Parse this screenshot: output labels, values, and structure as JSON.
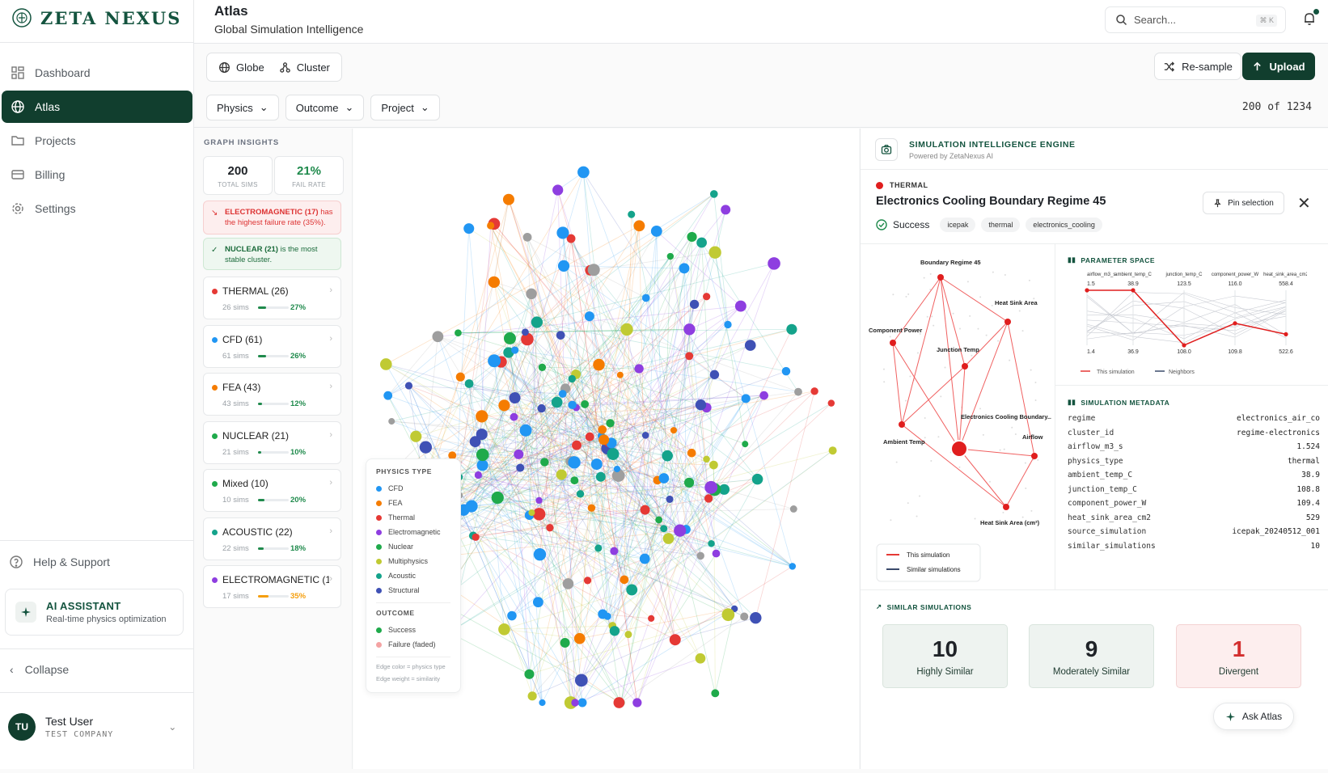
{
  "brand": {
    "name": "ZETA NEXUS"
  },
  "nav": [
    {
      "label": "Dashboard",
      "icon": "grid-icon"
    },
    {
      "label": "Atlas",
      "icon": "globe-icon",
      "active": true
    },
    {
      "label": "Projects",
      "icon": "folder-icon"
    },
    {
      "label": "Billing",
      "icon": "card-icon"
    },
    {
      "label": "Settings",
      "icon": "gear-icon"
    }
  ],
  "help_label": "Help & Support",
  "ai_assistant": {
    "title": "AI ASSISTANT",
    "subtitle": "Real-time physics optimization"
  },
  "collapse_label": "Collapse",
  "user": {
    "initials": "TU",
    "name": "Test User",
    "company": "TEST COMPANY"
  },
  "header": {
    "title": "Atlas",
    "subtitle": "Global Simulation Intelligence",
    "search_placeholder": "Search...",
    "search_kbd": "⌘ K"
  },
  "toolbar": {
    "view_globe": "Globe",
    "view_cluster": "Cluster",
    "resample": "Re-sample",
    "upload": "Upload",
    "filters": [
      "Physics",
      "Outcome",
      "Project"
    ],
    "count": "200 of 1234"
  },
  "insights": {
    "label": "GRAPH INSIGHTS",
    "total_value": "200",
    "total_label": "TOTAL SIMS",
    "fail_value": "21%",
    "fail_label": "FAIL RATE",
    "alert_red_strong": "ELECTROMAGNETIC (17)",
    "alert_red_text": " has the highest failure rate (35%).",
    "alert_green_strong": "NUCLEAR (21)",
    "alert_green_text": " is the most stable cluster.",
    "categories": [
      {
        "name": "THERMAL (26)",
        "sims": "26 sims",
        "pct": "27%",
        "value": 0.27,
        "color": "#e53935",
        "pct_color": "#1f8a4c"
      },
      {
        "name": "CFD (61)",
        "sims": "61 sims",
        "pct": "26%",
        "value": 0.26,
        "color": "#2196f3",
        "pct_color": "#1f8a4c"
      },
      {
        "name": "FEA (43)",
        "sims": "43 sims",
        "pct": "12%",
        "value": 0.12,
        "color": "#f57c00",
        "pct_color": "#1f8a4c"
      },
      {
        "name": "NUCLEAR (21)",
        "sims": "21 sims",
        "pct": "10%",
        "value": 0.1,
        "color": "#1faa4b",
        "pct_color": "#1f8a4c"
      },
      {
        "name": "Mixed (10)",
        "sims": "10 sims",
        "pct": "20%",
        "value": 0.2,
        "color": "#1faa4b",
        "pct_color": "#1f8a4c"
      },
      {
        "name": "ACOUSTIC (22)",
        "sims": "22 sims",
        "pct": "18%",
        "value": 0.18,
        "color": "#14a38b",
        "pct_color": "#1f8a4c"
      },
      {
        "name": "ELECTROMAGNETIC (17)",
        "sims": "17 sims",
        "pct": "35%",
        "value": 0.35,
        "color": "#8e3ee0",
        "pct_color": "#f59e0b"
      }
    ]
  },
  "legend": {
    "physics_title": "PHYSICS TYPE",
    "physics": [
      {
        "label": "CFD",
        "color": "#2196f3"
      },
      {
        "label": "FEA",
        "color": "#f57c00"
      },
      {
        "label": "Thermal",
        "color": "#e53935"
      },
      {
        "label": "Electromagnetic",
        "color": "#8e3ee0"
      },
      {
        "label": "Nuclear",
        "color": "#1faa4b"
      },
      {
        "label": "Multiphysics",
        "color": "#c0ca33"
      },
      {
        "label": "Acoustic",
        "color": "#14a38b"
      },
      {
        "label": "Structural",
        "color": "#3f51b5"
      }
    ],
    "outcome_title": "OUTCOME",
    "outcomes": [
      {
        "label": "Success",
        "color": "#1faa4b"
      },
      {
        "label": "Failure (faded)",
        "color": "#f4a3a3"
      }
    ],
    "note1": "Edge color = physics type",
    "note2": "Edge weight = similarity"
  },
  "engine": {
    "title": "SIMULATION INTELLIGENCE ENGINE",
    "subtitle": "Powered by ZetaNexus AI"
  },
  "selection": {
    "type": "THERMAL",
    "title": "Electronics Cooling Boundary Regime 45",
    "status": "Success",
    "tags": [
      "icepak",
      "thermal",
      "electronics_cooling"
    ],
    "pin_label": "Pin selection"
  },
  "radial": {
    "nodes": [
      "Boundary Regime 45",
      "Heat Sink Area",
      "Component Power",
      "Junction Temp",
      "Electronics Cooling Boundary...",
      "Ambient Temp",
      "Airflow",
      "Heat Sink Area (cm²)"
    ],
    "legend_this": "This simulation",
    "legend_similar": "Similar simulations"
  },
  "param_space": {
    "title": "PARAMETER SPACE",
    "axes": [
      "airflow_m3_s",
      "ambient_temp_C",
      "junction_temp_C",
      "component_power_W",
      "heat_sink_area_cm2"
    ],
    "max": [
      "1.5",
      "38.9",
      "123.5",
      "116.0",
      "558.4"
    ],
    "min": [
      "1.4",
      "36.9",
      "108.0",
      "109.8",
      "522.6"
    ],
    "this_sim_norm": [
      1.0,
      1.0,
      0.0,
      0.4,
      0.2
    ],
    "legend_this": "This simulation",
    "legend_neighbors": "Neighbors"
  },
  "metadata": {
    "title": "SIMULATION METADATA",
    "rows": [
      {
        "k": "regime",
        "v": "electronics_air_co"
      },
      {
        "k": "cluster_id",
        "v": "regime-electronics"
      },
      {
        "k": "airflow_m3_s",
        "v": "1.524"
      },
      {
        "k": "physics_type",
        "v": "thermal"
      },
      {
        "k": "ambient_temp_C",
        "v": "38.9"
      },
      {
        "k": "junction_temp_C",
        "v": "108.8"
      },
      {
        "k": "component_power_W",
        "v": "109.4"
      },
      {
        "k": "heat_sink_area_cm2",
        "v": "529"
      },
      {
        "k": "source_simulation",
        "v": "icepak_20240512_001"
      },
      {
        "k": "similar_simulations",
        "v": "10"
      }
    ]
  },
  "similar": {
    "title": "SIMILAR SIMULATIONS",
    "cards": [
      {
        "n": "10",
        "label": "Highly Similar"
      },
      {
        "n": "9",
        "label": "Moderately Similar"
      },
      {
        "n": "1",
        "label": "Divergent"
      }
    ]
  },
  "ask_label": "Ask Atlas",
  "colors": {
    "brand": "#113e2e",
    "accent": "#14543f",
    "thermal": "#e53935",
    "cfd": "#2196f3",
    "fea": "#f57c00",
    "nuclear": "#1faa4b",
    "em": "#8e3ee0",
    "acoustic": "#14a38b"
  }
}
